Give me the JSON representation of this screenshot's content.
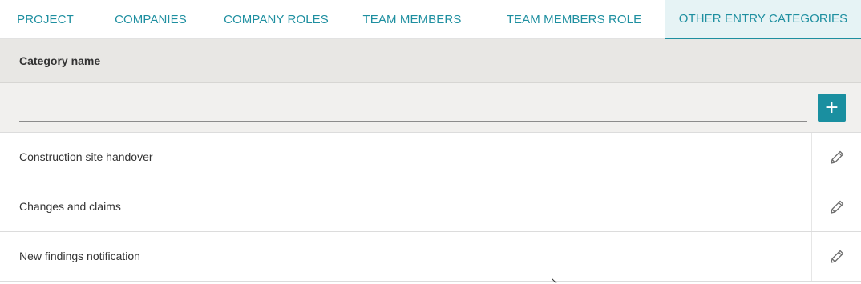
{
  "tabs": [
    {
      "label": "PROJECT",
      "active": false
    },
    {
      "label": "COMPANIES",
      "active": false
    },
    {
      "label": "COMPANY ROLES",
      "active": false
    },
    {
      "label": "TEAM MEMBERS",
      "active": false
    },
    {
      "label": "TEAM MEMBERS ROLE",
      "active": false
    },
    {
      "label": "OTHER ENTRY CATEGORIES",
      "active": true
    }
  ],
  "table": {
    "column_header": "Category name",
    "new_entry": {
      "value": "",
      "placeholder": "",
      "add_button_label": "+"
    },
    "rows": [
      {
        "name": "Construction site handover",
        "action_icon": "pencil-icon"
      },
      {
        "name": "Changes and claims",
        "action_icon": "pencil-icon"
      },
      {
        "name": "New findings notification",
        "action_icon": "pencil-icon"
      }
    ]
  },
  "colors": {
    "accent": "#1a8fa0",
    "active_tab_bg": "#e6f3f5",
    "header_bg": "#e8e7e4",
    "new_row_bg": "#f1f0ee"
  }
}
